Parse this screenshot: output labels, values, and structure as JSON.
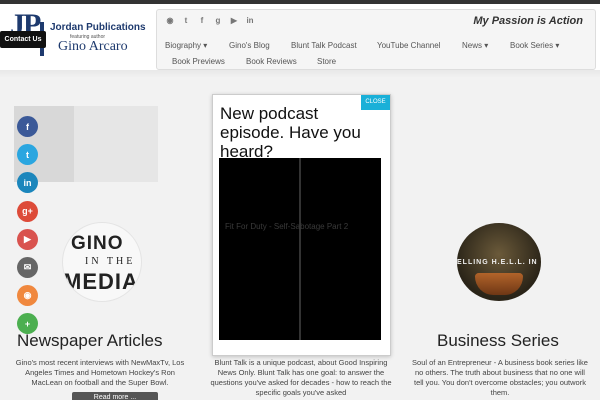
{
  "logo": {
    "initials": "JP",
    "publisher": "Jordan Publications",
    "featuring": "featuring author",
    "author": "Gino Arcaro"
  },
  "contact_button": "Contact Us",
  "tagline": "My Passion is Action",
  "social_icons": [
    "rss-icon",
    "twitter-icon",
    "facebook-icon",
    "google-plus-icon",
    "youtube-icon",
    "linkedin-icon"
  ],
  "nav": {
    "row1": [
      "Biography ▾",
      "Gino's Blog",
      "Blunt Talk Podcast",
      "YouTube Channel",
      "News ▾",
      "Book Series ▾"
    ],
    "row2": [
      "Book Previews",
      "Book Reviews",
      "Store"
    ]
  },
  "share_buttons": [
    {
      "name": "facebook-share-icon",
      "glyph": "f",
      "color": "#3b5998"
    },
    {
      "name": "twitter-share-icon",
      "glyph": "t",
      "color": "#2aa6e0"
    },
    {
      "name": "linkedin-share-icon",
      "glyph": "in",
      "color": "#1b86bc"
    },
    {
      "name": "google-plus-share-icon",
      "glyph": "g+",
      "color": "#dd4b39"
    },
    {
      "name": "youtube-share-icon",
      "glyph": "▶",
      "color": "#d9534f"
    },
    {
      "name": "email-share-icon",
      "glyph": "✉",
      "color": "#666666"
    },
    {
      "name": "rss-share-icon",
      "glyph": "◉",
      "color": "#f0883e"
    },
    {
      "name": "more-share-icon",
      "glyph": "+",
      "color": "#4caf50"
    }
  ],
  "media_circle": {
    "line1": "GINO",
    "line2": "IN THE",
    "line3": "MEDIA"
  },
  "columns": {
    "left": {
      "title": "Newspaper Articles",
      "text": "Gino's most recent interviews with NewMaxTv, Los Angeles Times and Hometown Hockey's Ron MacLean on football and the Super Bowl.",
      "button": "Read more ..."
    },
    "middle": {
      "text": "Blunt Talk is a unique podcast, about Good Inspiring News Only. Blunt Talk has one goal: to answer the questions you've asked for decades - how to reach the specific goals you've asked"
    },
    "right": {
      "title": "Business Series",
      "text": "Soul of an Entrepreneur - A business book series like no others. The truth about business that no one will tell you. You don't overcome obstacles; you outwork them.",
      "circle_text": "ELLING H.E.L.L. IN"
    }
  },
  "popup": {
    "close": "CLOSE",
    "heading": "New podcast episode. Have you heard?",
    "video_title": "Fit For Duty - Self-Sabotage Part 2"
  },
  "colors": {
    "popup_close": "#1ab0d8",
    "logo_blue": "#1e3a6e"
  }
}
